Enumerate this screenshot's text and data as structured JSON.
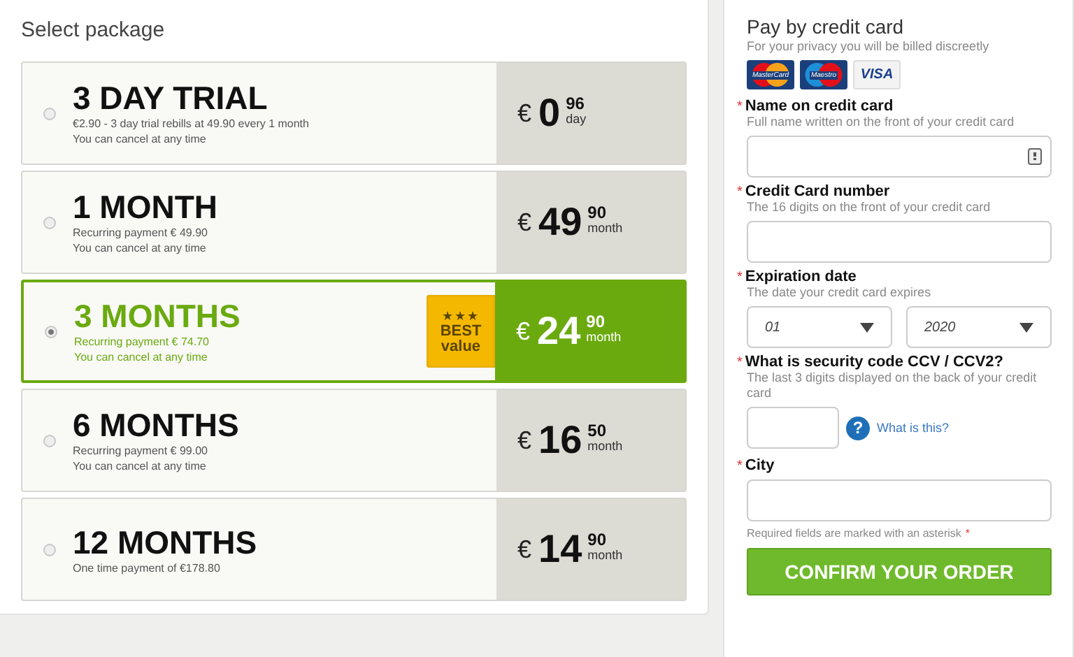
{
  "packages_panel": {
    "title": "Select package",
    "packages": [
      {
        "name": "3 DAY TRIAL",
        "details": [
          "€2.90 - 3 day trial rebills at 49.90 every 1 month",
          "You can cancel at any time"
        ],
        "currency": "€",
        "price_whole": "0",
        "price_cents": "96",
        "period": "day",
        "selected": false
      },
      {
        "name": "1 MONTH",
        "details": [
          "Recurring payment € 49.90",
          "You can cancel at any time"
        ],
        "currency": "€",
        "price_whole": "49",
        "price_cents": "90",
        "period": "month",
        "selected": false
      },
      {
        "name": "3 MONTHS",
        "details": [
          "Recurring payment € 74.70",
          "You can cancel at any time"
        ],
        "currency": "€",
        "price_whole": "24",
        "price_cents": "90",
        "period": "month",
        "selected": true,
        "badge": {
          "stars": "★★★",
          "lines": [
            "BEST",
            "value"
          ]
        }
      },
      {
        "name": "6 MONTHS",
        "details": [
          "Recurring payment € 99.00",
          "You can cancel at any time"
        ],
        "currency": "€",
        "price_whole": "16",
        "price_cents": "50",
        "period": "month",
        "selected": false
      },
      {
        "name": "12 MONTHS",
        "details": [
          "One time payment of €178.80"
        ],
        "currency": "€",
        "price_whole": "14",
        "price_cents": "90",
        "period": "month",
        "selected": false
      }
    ]
  },
  "payment_panel": {
    "title": "Pay by credit card",
    "subtitle": "For your privacy you will be billed discreetly",
    "cards": [
      {
        "kind": "mastercard",
        "label": "MasterCard"
      },
      {
        "kind": "maestro",
        "label": "Maestro"
      },
      {
        "kind": "visa",
        "label": "VISA"
      }
    ],
    "fields": [
      {
        "kind": "text",
        "marker": "*",
        "label": "Name on credit card",
        "hint": "Full name written on the front of your credit card",
        "autofill_icon": true
      },
      {
        "kind": "text",
        "marker": "*",
        "label": "Credit Card number",
        "hint": "The 16 digits on the front of your credit card"
      },
      {
        "kind": "selects",
        "marker": "*",
        "label": "Expiration date",
        "hint": "The date your credit card expires",
        "selects": [
          "01",
          "2020"
        ]
      },
      {
        "kind": "code",
        "marker": "*",
        "label": "What is security code CCV / CCV2?",
        "hint": "The last 3 digits displayed on the back of your credit card",
        "help_icon": "?",
        "help_link": "What is this?"
      },
      {
        "kind": "text",
        "marker": "*",
        "label": "City"
      }
    ],
    "note": "Required fields are marked with an asterisk",
    "note_marker": "*",
    "confirm_button": "CONFIRM YOUR ORDER"
  }
}
